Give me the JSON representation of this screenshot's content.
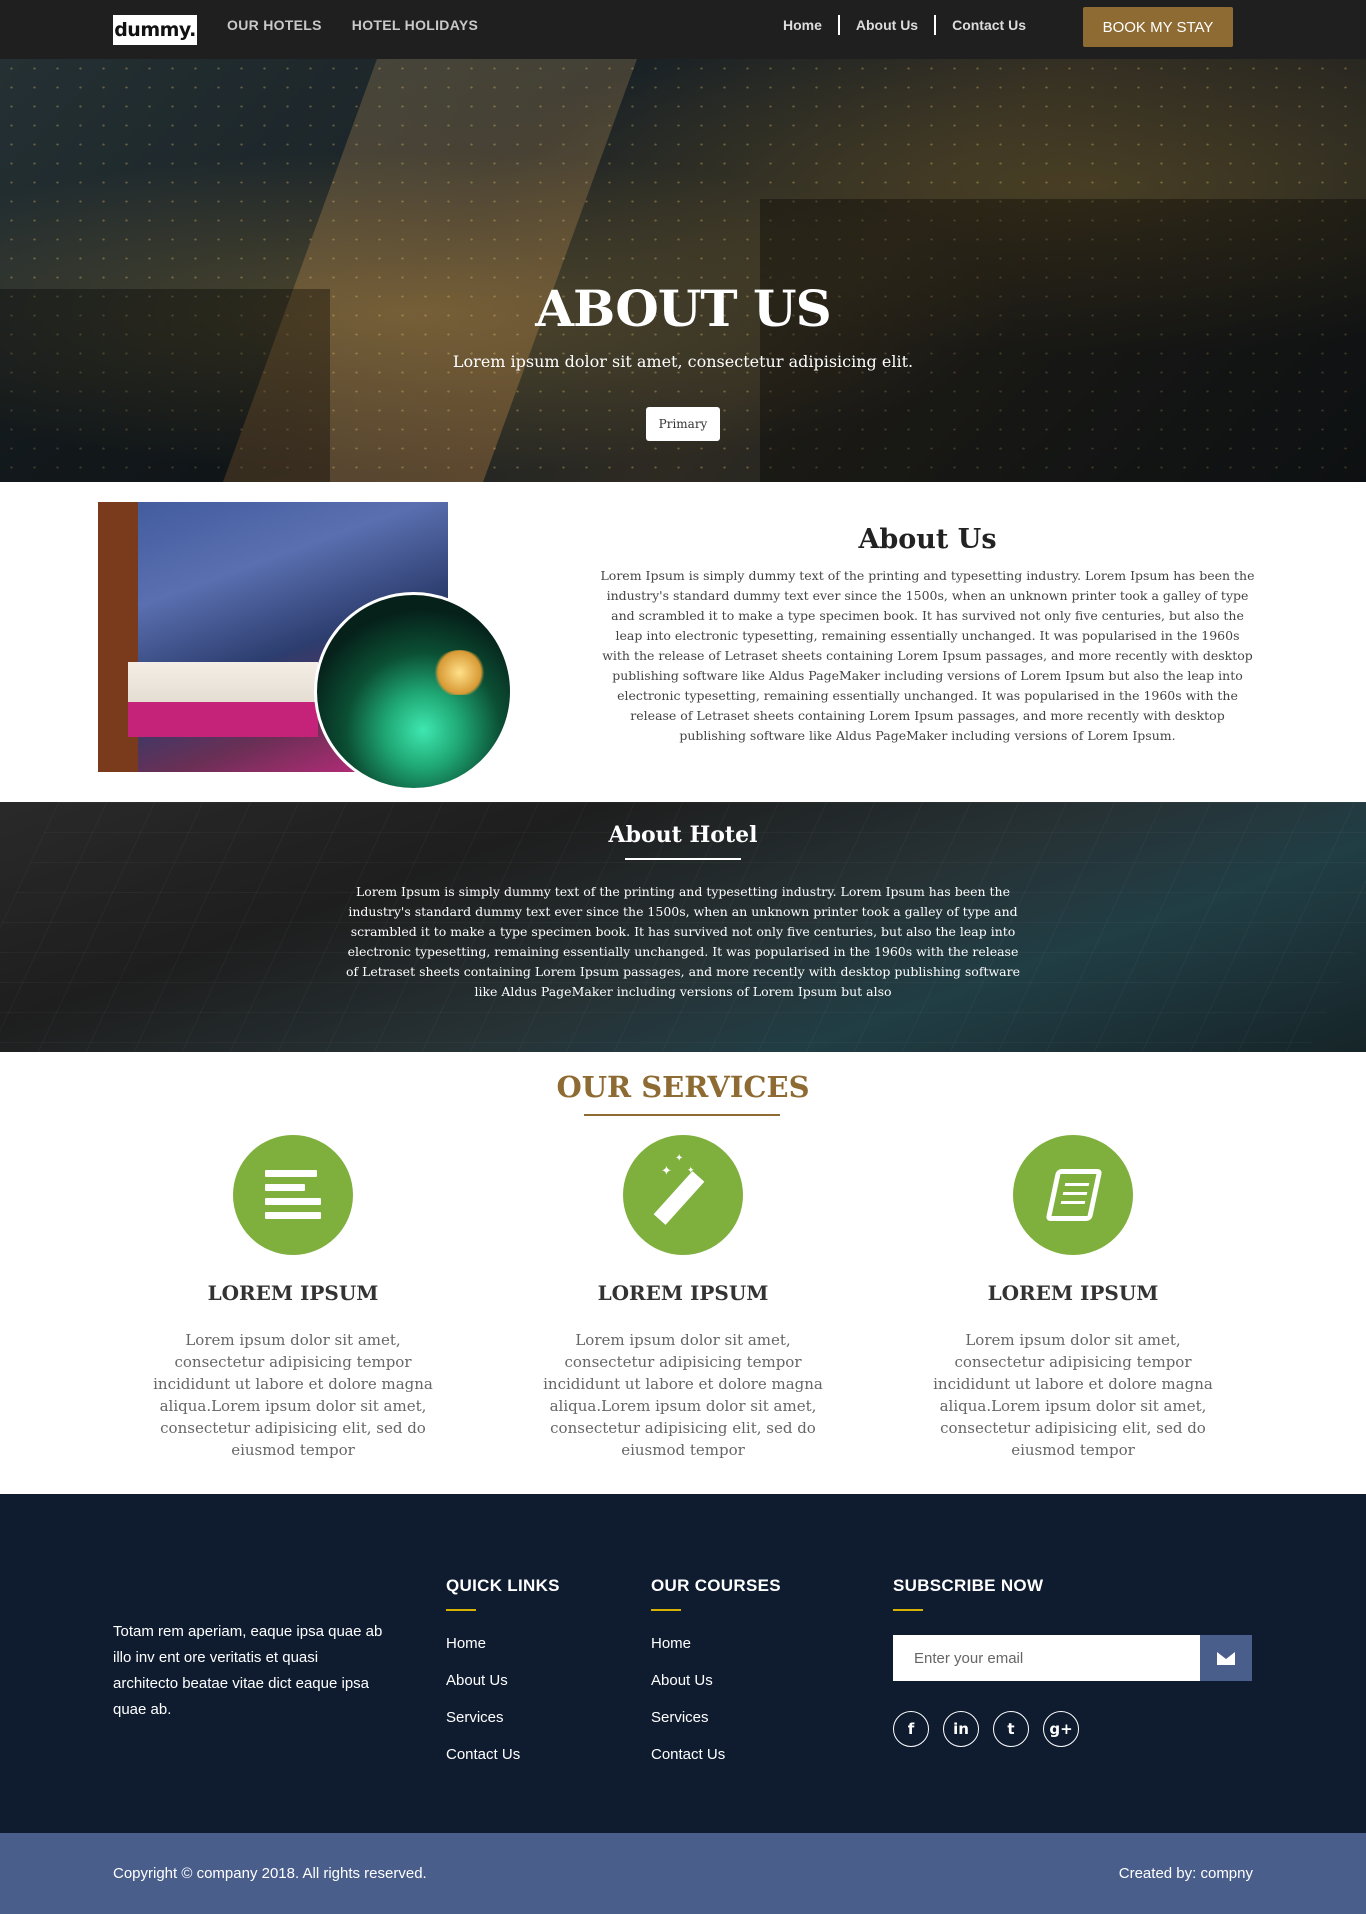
{
  "nav": {
    "logo": "dummy.",
    "left_links": [
      "OUR HOTELS",
      "HOTEL HOLIDAYS"
    ],
    "right_links": [
      "Home",
      "About Us",
      "Contact Us"
    ],
    "book_label": "BOOK MY STAY"
  },
  "hero": {
    "title": "ABOUT US",
    "subtitle": "Lorem ipsum dolor sit amet, consectetur adipisicing elit.",
    "button": "Primary"
  },
  "about": {
    "title": "About Us",
    "text": "Lorem Ipsum is simply dummy text of the printing and typesetting industry. Lorem Ipsum has been the industry's standard dummy text ever since the 1500s, when an unknown printer took a galley of type and scrambled it to make a type specimen book. It has survived not only five centuries, but also the leap into electronic typesetting, remaining essentially unchanged. It was popularised in the 1960s with the release of Letraset sheets containing Lorem Ipsum passages, and more recently with desktop publishing software like Aldus PageMaker including versions of Lorem Ipsum but also the leap into electronic typesetting, remaining essentially unchanged. It was popularised in the 1960s with the release of Letraset sheets containing Lorem Ipsum passages, and more recently with desktop publishing software like Aldus PageMaker including versions of Lorem Ipsum."
  },
  "hotel": {
    "title": "About Hotel",
    "text": "Lorem Ipsum is simply dummy text of the printing and typesetting industry. Lorem Ipsum has been the industry's standard dummy text ever since the 1500s, when an unknown printer took a galley of type and scrambled it to make a type specimen book. It has survived not only five centuries, but also the leap into electronic typesetting, remaining essentially unchanged. It was popularised in the 1960s with the release of Letraset sheets containing Lorem Ipsum passages, and more recently with desktop publishing software like Aldus PageMaker including versions of Lorem Ipsum but also"
  },
  "services": {
    "title": "OUR SERVICES",
    "accent_color": "#7fb03d",
    "items": [
      {
        "icon": "align-lines-icon",
        "name": "LOREM IPSUM",
        "text": "Lorem ipsum dolor sit amet, consectetur adipisicing tempor incididunt ut labore et dolore magna aliqua.Lorem ipsum dolor sit amet, consectetur adipisicing elit, sed do eiusmod tempor"
      },
      {
        "icon": "magic-wand-icon",
        "name": "LOREM IPSUM",
        "text": "Lorem ipsum dolor sit amet, consectetur adipisicing tempor incididunt ut labore et dolore magna aliqua.Lorem ipsum dolor sit amet, consectetur adipisicing elit, sed do eiusmod tempor"
      },
      {
        "icon": "book-icon",
        "name": "LOREM IPSUM",
        "text": "Lorem ipsum dolor sit amet, consectetur adipisicing tempor incididunt ut labore et dolore magna aliqua.Lorem ipsum dolor sit amet, consectetur adipisicing elit, sed do eiusmod tempor"
      }
    ]
  },
  "footer": {
    "about": "Totam rem aperiam, eaque ipsa quae ab illo inv ent ore veritatis et quasi architecto beatae vitae dict eaque ipsa quae ab.",
    "quick_links": {
      "title": "QUICK LINKS",
      "items": [
        "Home",
        "About Us",
        "Services",
        "Contact Us"
      ]
    },
    "courses": {
      "title": "OUR COURSES",
      "items": [
        "Home",
        "About Us",
        "Services",
        "Contact Us"
      ]
    },
    "subscribe": {
      "title": "SUBSCRIBE NOW",
      "placeholder": "Enter your email"
    },
    "socials": [
      {
        "icon": "facebook-icon",
        "glyph": "f"
      },
      {
        "icon": "linkedin-icon",
        "glyph": "in"
      },
      {
        "icon": "twitter-icon",
        "glyph": "t"
      },
      {
        "icon": "google-plus-icon",
        "glyph": "g+"
      }
    ],
    "copyright": "Copyright © company 2018. All rights reserved.",
    "created_by": "Created by: compny"
  }
}
